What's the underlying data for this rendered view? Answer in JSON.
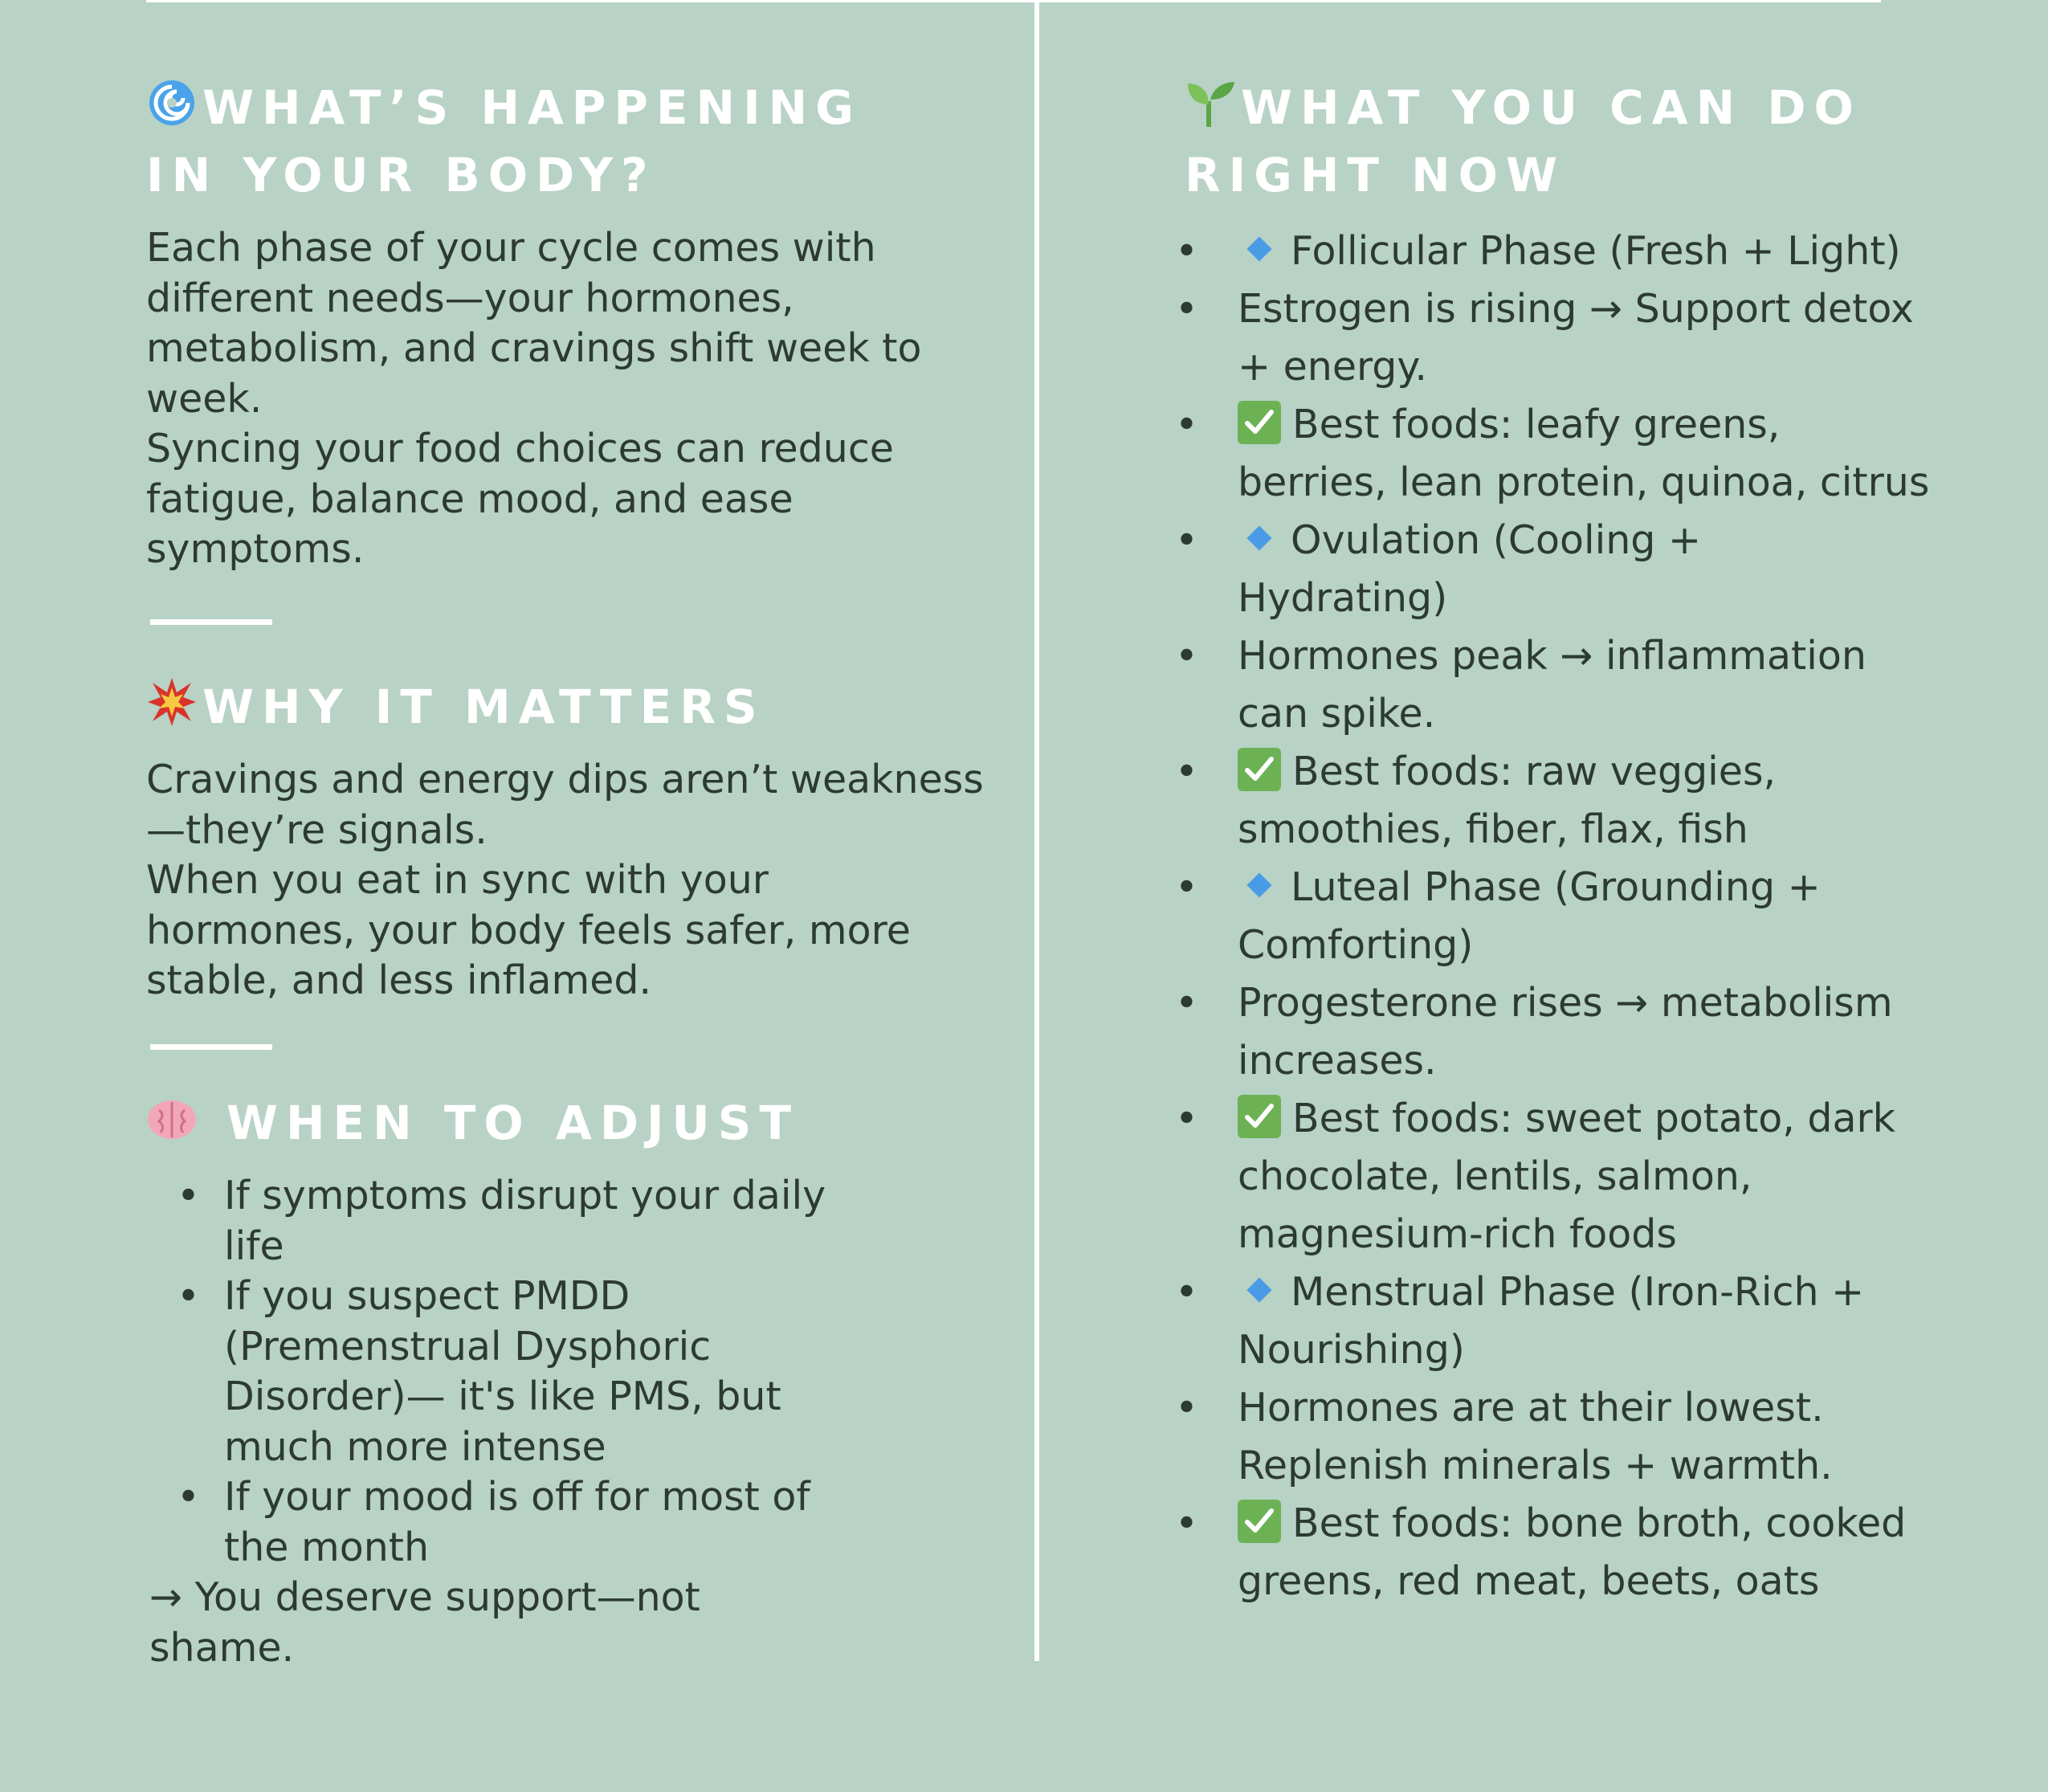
{
  "left": {
    "section1": {
      "icon": "cyclone-icon",
      "heading_line1": "WHAT’S HAPPENING",
      "heading_line2": "IN YOUR BODY?",
      "para1_lines": [
        "Each phase of your cycle comes with",
        "different needs—your hormones,",
        "metabolism, and cravings shift week to",
        "week."
      ],
      "para2_lines": [
        "Syncing your food choices can reduce",
        "fatigue, balance mood, and ease",
        "symptoms."
      ]
    },
    "section2": {
      "icon": "collision-icon",
      "heading": "WHY IT MATTERS",
      "para1_lines": [
        "Cravings and energy dips aren’t weakness",
        "—they’re signals."
      ],
      "para2_lines": [
        "When you eat in sync with your",
        "hormones, your body feels safer, more",
        "stable, and less inflamed."
      ]
    },
    "section3": {
      "icon": "brain-icon",
      "heading": "WHEN TO ADJUST",
      "items": [
        {
          "lines": [
            "If symptoms disrupt your daily",
            "life"
          ]
        },
        {
          "lines": [
            "If you suspect PMDD",
            "(Premenstrual Dysphoric",
            "Disorder)— it's like PMS, but",
            "much more intense"
          ]
        },
        {
          "lines": [
            "If your mood is off for most of",
            "the month"
          ]
        }
      ],
      "closing_lines": [
        "→ You deserve support—not",
        "shame."
      ]
    }
  },
  "right": {
    "icon": "seedling-icon",
    "heading_line1": "WHAT YOU CAN DO",
    "heading_line2": "RIGHT NOW",
    "items": [
      {
        "marker": "diamond",
        "lines": [
          "Follicular Phase (Fresh + Light)"
        ]
      },
      {
        "marker": "none",
        "lines": [
          "Estrogen is rising → Support detox",
          "+ energy."
        ]
      },
      {
        "marker": "check",
        "lines": [
          "Best foods: leafy greens,",
          "berries, lean protein, quinoa, citrus"
        ]
      },
      {
        "marker": "diamond",
        "lines": [
          "Ovulation (Cooling +",
          "Hydrating)"
        ]
      },
      {
        "marker": "none",
        "lines": [
          "Hormones peak → inflammation",
          "can spike."
        ]
      },
      {
        "marker": "check",
        "lines": [
          "Best foods: raw veggies,",
          "smoothies, fiber, flax, fish"
        ]
      },
      {
        "marker": "diamond",
        "lines": [
          "Luteal Phase (Grounding +",
          "Comforting)"
        ]
      },
      {
        "marker": "none",
        "lines": [
          "Progesterone rises → metabolism",
          "increases."
        ]
      },
      {
        "marker": "check",
        "lines": [
          "Best foods: sweet potato, dark",
          "chocolate, lentils, salmon,",
          "magnesium-rich foods"
        ]
      },
      {
        "marker": "diamond",
        "lines": [
          "Menstrual Phase (Iron-Rich +",
          "Nourishing)"
        ]
      },
      {
        "marker": "none",
        "lines": [
          "Hormones are at their lowest.",
          "Replenish minerals + warmth."
        ]
      },
      {
        "marker": "check",
        "lines": [
          "Best foods: bone broth, cooked",
          "greens, red meat, beets, oats"
        ]
      }
    ],
    "bullet_char": "•"
  },
  "colors": {
    "background": "#b8d2c6",
    "heading": "#ffffff",
    "body_text": "#2d3a34",
    "diamond": "#4a9be6",
    "check": "#6cb255"
  }
}
